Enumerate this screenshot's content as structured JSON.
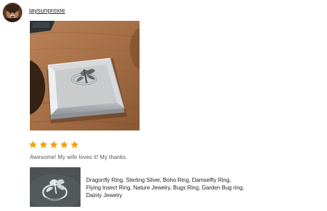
{
  "reviewer": {
    "username": "jaysunproxie",
    "avatar_icon": "reviewer-avatar"
  },
  "review": {
    "photo_icon": "ring-in-gift-box-photo",
    "rating": 5,
    "rating_max": 5,
    "star_color": "#f1a10e",
    "text": "Awesome! My wife loves it! My thanks."
  },
  "listing": {
    "thumbnail_icon": "dragonfly-ring-thumbnail",
    "title": "Dragonfly Ring, Sterling Silver, Boho Ring, Damselfly Ring, Flying Insect Ring, Nature Jewelry, Bugs Ring, Garden Bug ring, Dainty Jewelry"
  }
}
